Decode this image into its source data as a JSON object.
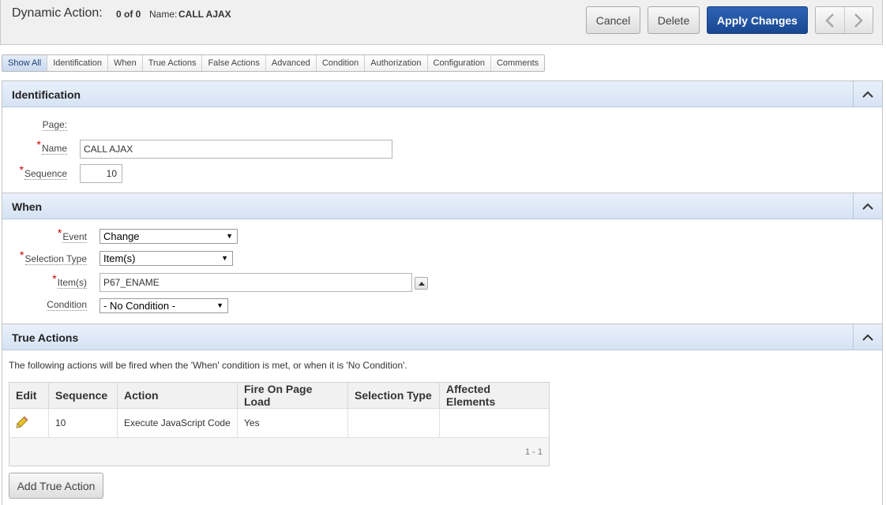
{
  "header": {
    "title": "Dynamic Action:",
    "count": "0 of 0",
    "name_label": "Name:",
    "name_value": "CALL AJAX",
    "buttons": {
      "cancel": "Cancel",
      "delete": "Delete",
      "apply": "Apply Changes"
    },
    "colors": {
      "apply_bg": "#1f4f9e"
    }
  },
  "tabs": [
    {
      "label": "Show All",
      "active": true
    },
    {
      "label": "Identification"
    },
    {
      "label": "When"
    },
    {
      "label": "True Actions"
    },
    {
      "label": "False Actions"
    },
    {
      "label": "Advanced"
    },
    {
      "label": "Condition"
    },
    {
      "label": "Authorization"
    },
    {
      "label": "Configuration"
    },
    {
      "label": "Comments"
    }
  ],
  "identification": {
    "title": "Identification",
    "page_label": "Page:",
    "name_label": "Name",
    "name_value": "CALL AJAX",
    "sequence_label": "Sequence",
    "sequence_value": "10"
  },
  "when": {
    "title": "When",
    "event_label": "Event",
    "event_value": "Change",
    "selection_type_label": "Selection Type",
    "selection_type_value": "Item(s)",
    "items_label": "Item(s)",
    "items_value": "P67_ENAME",
    "condition_label": "Condition",
    "condition_value": "- No Condition -"
  },
  "true_actions": {
    "title": "True Actions",
    "note": "The following actions will be fired when the 'When' condition is met, or when it is 'No Condition'.",
    "columns": [
      "Edit",
      "Sequence",
      "Action",
      "Fire On Page Load",
      "Selection Type",
      "Affected Elements"
    ],
    "rows": [
      {
        "sequence": "10",
        "action": "Execute JavaScript Code",
        "fire_on_load": "Yes",
        "selection_type": "",
        "affected": ""
      }
    ],
    "pagination": "1 - 1",
    "add_button": "Add True Action"
  },
  "icons": {
    "prev": "chevron-left-icon",
    "next": "chevron-right-icon",
    "collapse": "chevron-up-icon",
    "edit": "pencil-icon"
  }
}
